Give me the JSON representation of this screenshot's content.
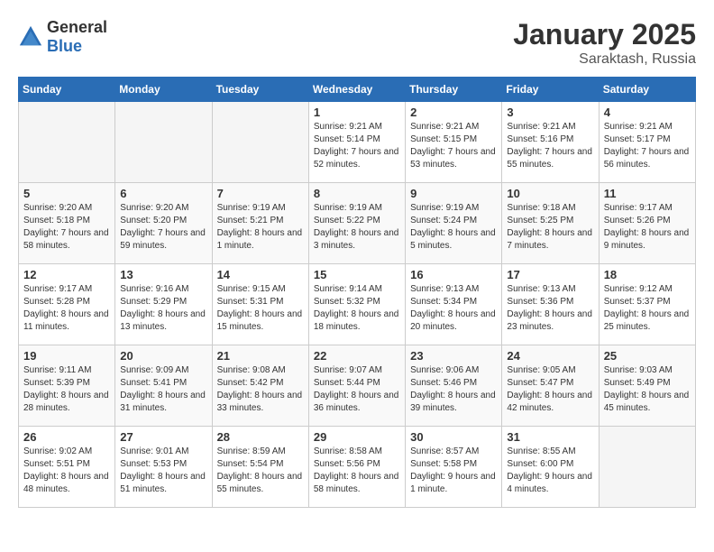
{
  "header": {
    "logo_general": "General",
    "logo_blue": "Blue",
    "month_year": "January 2025",
    "location": "Saraktash, Russia"
  },
  "days_of_week": [
    "Sunday",
    "Monday",
    "Tuesday",
    "Wednesday",
    "Thursday",
    "Friday",
    "Saturday"
  ],
  "weeks": [
    [
      {
        "day": "",
        "empty": true
      },
      {
        "day": "",
        "empty": true
      },
      {
        "day": "",
        "empty": true
      },
      {
        "day": "1",
        "sunrise": "9:21 AM",
        "sunset": "5:14 PM",
        "daylight": "7 hours and 52 minutes."
      },
      {
        "day": "2",
        "sunrise": "9:21 AM",
        "sunset": "5:15 PM",
        "daylight": "7 hours and 53 minutes."
      },
      {
        "day": "3",
        "sunrise": "9:21 AM",
        "sunset": "5:16 PM",
        "daylight": "7 hours and 55 minutes."
      },
      {
        "day": "4",
        "sunrise": "9:21 AM",
        "sunset": "5:17 PM",
        "daylight": "7 hours and 56 minutes."
      }
    ],
    [
      {
        "day": "5",
        "sunrise": "9:20 AM",
        "sunset": "5:18 PM",
        "daylight": "7 hours and 58 minutes."
      },
      {
        "day": "6",
        "sunrise": "9:20 AM",
        "sunset": "5:20 PM",
        "daylight": "7 hours and 59 minutes."
      },
      {
        "day": "7",
        "sunrise": "9:19 AM",
        "sunset": "5:21 PM",
        "daylight": "8 hours and 1 minute."
      },
      {
        "day": "8",
        "sunrise": "9:19 AM",
        "sunset": "5:22 PM",
        "daylight": "8 hours and 3 minutes."
      },
      {
        "day": "9",
        "sunrise": "9:19 AM",
        "sunset": "5:24 PM",
        "daylight": "8 hours and 5 minutes."
      },
      {
        "day": "10",
        "sunrise": "9:18 AM",
        "sunset": "5:25 PM",
        "daylight": "8 hours and 7 minutes."
      },
      {
        "day": "11",
        "sunrise": "9:17 AM",
        "sunset": "5:26 PM",
        "daylight": "8 hours and 9 minutes."
      }
    ],
    [
      {
        "day": "12",
        "sunrise": "9:17 AM",
        "sunset": "5:28 PM",
        "daylight": "8 hours and 11 minutes."
      },
      {
        "day": "13",
        "sunrise": "9:16 AM",
        "sunset": "5:29 PM",
        "daylight": "8 hours and 13 minutes."
      },
      {
        "day": "14",
        "sunrise": "9:15 AM",
        "sunset": "5:31 PM",
        "daylight": "8 hours and 15 minutes."
      },
      {
        "day": "15",
        "sunrise": "9:14 AM",
        "sunset": "5:32 PM",
        "daylight": "8 hours and 18 minutes."
      },
      {
        "day": "16",
        "sunrise": "9:13 AM",
        "sunset": "5:34 PM",
        "daylight": "8 hours and 20 minutes."
      },
      {
        "day": "17",
        "sunrise": "9:13 AM",
        "sunset": "5:36 PM",
        "daylight": "8 hours and 23 minutes."
      },
      {
        "day": "18",
        "sunrise": "9:12 AM",
        "sunset": "5:37 PM",
        "daylight": "8 hours and 25 minutes."
      }
    ],
    [
      {
        "day": "19",
        "sunrise": "9:11 AM",
        "sunset": "5:39 PM",
        "daylight": "8 hours and 28 minutes."
      },
      {
        "day": "20",
        "sunrise": "9:09 AM",
        "sunset": "5:41 PM",
        "daylight": "8 hours and 31 minutes."
      },
      {
        "day": "21",
        "sunrise": "9:08 AM",
        "sunset": "5:42 PM",
        "daylight": "8 hours and 33 minutes."
      },
      {
        "day": "22",
        "sunrise": "9:07 AM",
        "sunset": "5:44 PM",
        "daylight": "8 hours and 36 minutes."
      },
      {
        "day": "23",
        "sunrise": "9:06 AM",
        "sunset": "5:46 PM",
        "daylight": "8 hours and 39 minutes."
      },
      {
        "day": "24",
        "sunrise": "9:05 AM",
        "sunset": "5:47 PM",
        "daylight": "8 hours and 42 minutes."
      },
      {
        "day": "25",
        "sunrise": "9:03 AM",
        "sunset": "5:49 PM",
        "daylight": "8 hours and 45 minutes."
      }
    ],
    [
      {
        "day": "26",
        "sunrise": "9:02 AM",
        "sunset": "5:51 PM",
        "daylight": "8 hours and 48 minutes."
      },
      {
        "day": "27",
        "sunrise": "9:01 AM",
        "sunset": "5:53 PM",
        "daylight": "8 hours and 51 minutes."
      },
      {
        "day": "28",
        "sunrise": "8:59 AM",
        "sunset": "5:54 PM",
        "daylight": "8 hours and 55 minutes."
      },
      {
        "day": "29",
        "sunrise": "8:58 AM",
        "sunset": "5:56 PM",
        "daylight": "8 hours and 58 minutes."
      },
      {
        "day": "30",
        "sunrise": "8:57 AM",
        "sunset": "5:58 PM",
        "daylight": "9 hours and 1 minute."
      },
      {
        "day": "31",
        "sunrise": "8:55 AM",
        "sunset": "6:00 PM",
        "daylight": "9 hours and 4 minutes."
      },
      {
        "day": "",
        "empty": true
      }
    ]
  ]
}
